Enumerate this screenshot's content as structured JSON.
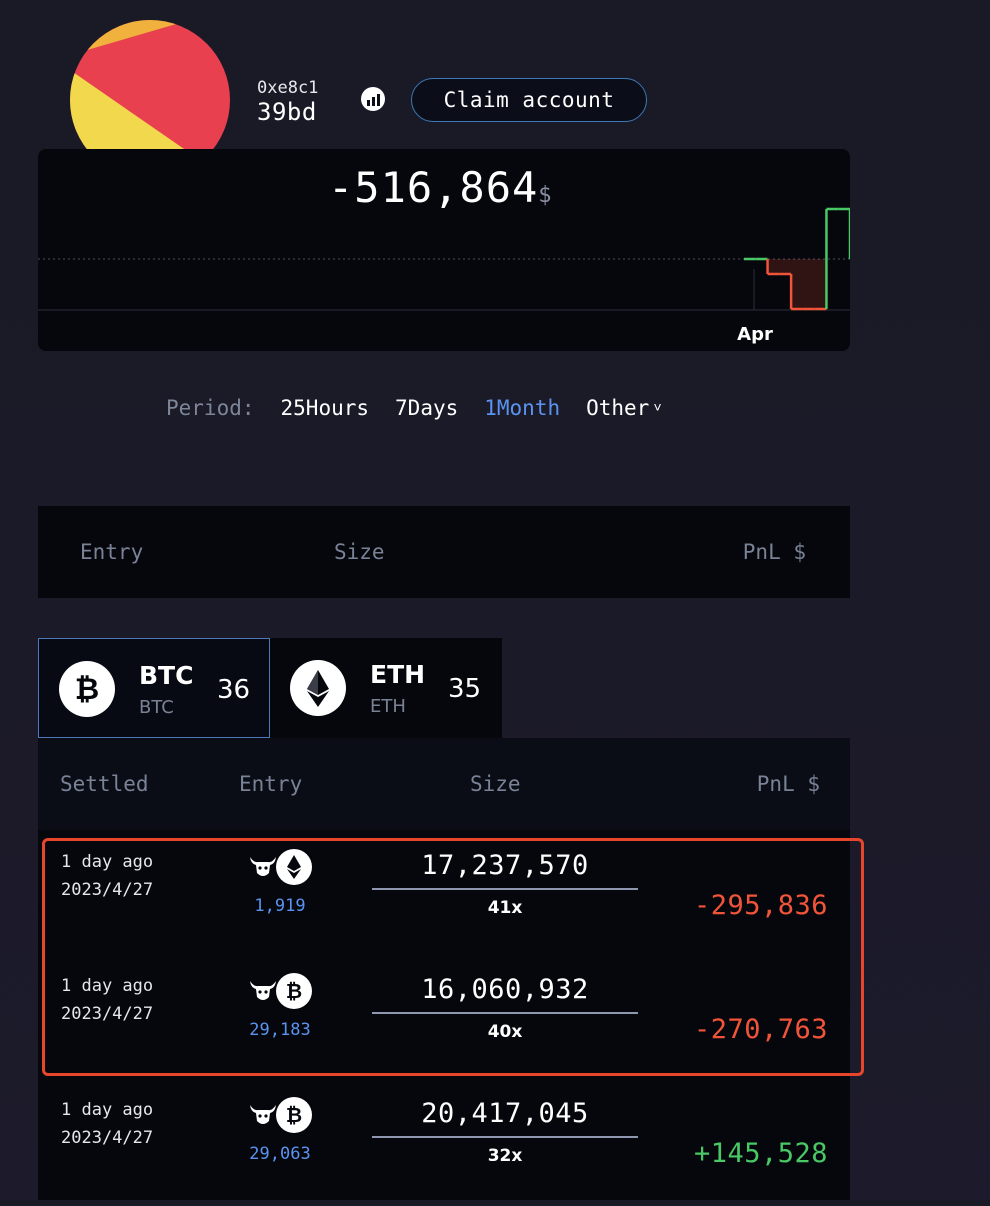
{
  "header": {
    "address_line1": "0xe8c1",
    "address_line2": "39bd",
    "claim_label": "Claim account"
  },
  "chart": {
    "total_value": "-516,864",
    "currency": "$",
    "x_tick": "Apr",
    "colors": {
      "up": "#4ac865",
      "down": "#f2543a"
    }
  },
  "chart_data": {
    "type": "line",
    "title": "",
    "xlabel": "",
    "ylabel": "",
    "x_ticks": [
      "Apr"
    ],
    "series": [
      {
        "values": [
          0,
          0,
          -18000,
          -18000,
          -60000,
          -60000,
          -60000,
          60000,
          60000,
          0
        ]
      }
    ],
    "grid": false
  },
  "period": {
    "label": "Period:",
    "options": [
      "25Hours",
      "7Days",
      "1Month",
      "Other"
    ],
    "active": "1Month"
  },
  "summary": {
    "headers": [
      "Entry",
      "Size",
      "PnL $"
    ]
  },
  "asset_tabs": [
    {
      "symbol": "BTC",
      "sub": "BTC",
      "count": "36",
      "icon": "bitcoin-icon",
      "selected": true
    },
    {
      "symbol": "ETH",
      "sub": "ETH",
      "count": "35",
      "icon": "ethereum-icon",
      "selected": false
    }
  ],
  "trades": {
    "headers": [
      "Settled",
      "Entry",
      "Size",
      "PnL $"
    ],
    "rows": [
      {
        "ago": "1 day ago",
        "date": "2023/4/27",
        "coin": "ethereum-icon",
        "side": "bull-icon",
        "entry": "1,919",
        "size": "17,237,570",
        "leverage": "41x",
        "pnl": "-295,836"
      },
      {
        "ago": "1 day ago",
        "date": "2023/4/27",
        "coin": "bitcoin-icon",
        "side": "bull-icon",
        "entry": "29,183",
        "size": "16,060,932",
        "leverage": "40x",
        "pnl": "-270,763"
      },
      {
        "ago": "1 day ago",
        "date": "2023/4/27",
        "coin": "bitcoin-icon",
        "side": "bull-icon",
        "entry": "29,063",
        "size": "20,417,045",
        "leverage": "32x",
        "pnl": "+145,528"
      }
    ]
  }
}
